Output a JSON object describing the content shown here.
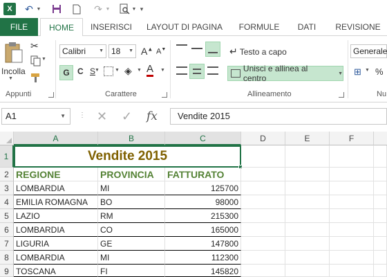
{
  "quick_access": {
    "undo": "↶",
    "redo": "↷"
  },
  "tabs": [
    "FILE",
    "HOME",
    "INSERISCI",
    "LAYOUT DI PAGINA",
    "FORMULE",
    "DATI",
    "REVISIONE"
  ],
  "ribbon": {
    "clipboard": {
      "paste_label": "Incolla",
      "group_label": "Appunti"
    },
    "font": {
      "name": "Calibri",
      "size": "18",
      "grow": "A",
      "shrink": "A",
      "bold": "G",
      "italic": "C",
      "underline": "S",
      "font_color": "A",
      "group_label": "Carattere"
    },
    "alignment": {
      "wrap_text": "Testo a capo",
      "merge_center": "Unisci e allinea al centro",
      "group_label": "Allineamento"
    },
    "number": {
      "format": "Generale",
      "group_label": "Nu"
    }
  },
  "formula_bar": {
    "name_box": "A1",
    "value": "Vendite 2015",
    "fx": "fx"
  },
  "columns": [
    "A",
    "B",
    "C",
    "D",
    "E",
    "F"
  ],
  "rows": [
    "1",
    "2",
    "3",
    "4",
    "5",
    "6",
    "7",
    "8",
    "9"
  ],
  "sheet": {
    "title": "Vendite 2015",
    "headers": [
      "REGIONE",
      "PROVINCIA",
      "FATTURATO"
    ],
    "data": [
      [
        "LOMBARDIA",
        "MI",
        "125700"
      ],
      [
        "EMILIA ROMAGNA",
        "BO",
        "98000"
      ],
      [
        "LAZIO",
        "RM",
        "215300"
      ],
      [
        "LOMBARDIA",
        "CO",
        "165000"
      ],
      [
        "LIGURIA",
        "GE",
        "147800"
      ],
      [
        "LOMBARDIA",
        "MI",
        "112300"
      ],
      [
        "TOSCANA",
        "FI",
        "145820"
      ]
    ]
  },
  "colors": {
    "excel_green": "#217346",
    "title_color": "#7f6000",
    "header_color": "#548235"
  }
}
